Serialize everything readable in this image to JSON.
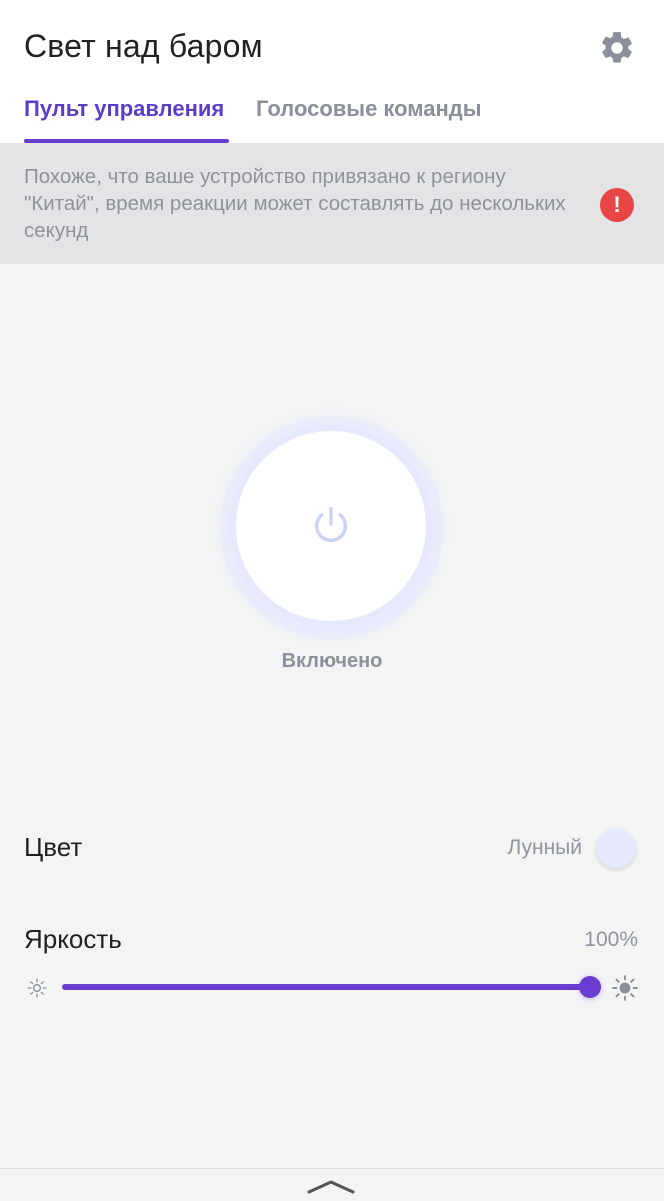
{
  "header": {
    "title": "Свет над баром",
    "settings_icon": "gear-icon",
    "tabs": [
      {
        "label": "Пульт управления",
        "active": true
      },
      {
        "label": "Голосовые команды",
        "active": false
      }
    ]
  },
  "banner": {
    "text": "Похоже, что ваше устройство привязано к региону \"Китай\", время реакции может составлять до нескольких секунд",
    "icon": "alert-icon",
    "icon_glyph": "!"
  },
  "power": {
    "icon": "power-icon",
    "state_label": "Включено"
  },
  "color": {
    "label": "Цвет",
    "value": "Лунный",
    "swatch_color": "#e6e9fc"
  },
  "brightness": {
    "label": "Яркость",
    "value_label": "100%",
    "level": 1.0
  },
  "colors": {
    "accent": "#6a3ccf",
    "alert": "#e84545"
  },
  "bottom": {
    "icon": "chevron-up-icon"
  }
}
